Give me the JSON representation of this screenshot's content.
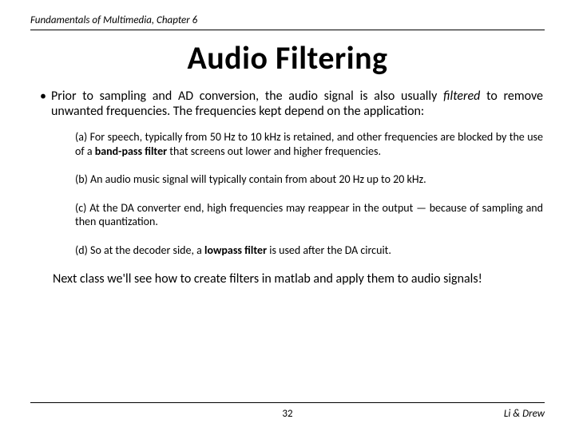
{
  "header": {
    "text": "Fundamentals of Multimedia, Chapter 6"
  },
  "title": "Audio Filtering",
  "bullet": {
    "marker": "•",
    "pre": "Prior to sampling and AD conversion, the audio signal is also usually ",
    "italic": "filtered",
    "post": " to remove unwanted frequencies. The frequencies kept depend on the application:"
  },
  "items": [
    {
      "label": "(a)",
      "pre": " For speech, typically from 50 Hz to 10 kHz is retained, and other frequencies are blocked by the use of a ",
      "bold": "band-pass filter",
      "post": " that screens out lower and higher frequencies."
    },
    {
      "label": "(b)",
      "pre": " An audio music signal will typically contain from about 20 Hz up to 20 kHz.",
      "bold": "",
      "post": ""
    },
    {
      "label": "(c)",
      "pre": " At the DA converter end, high frequencies may reappear in the output — because of sampling and then quantization.",
      "bold": "",
      "post": ""
    },
    {
      "label": "(d)",
      "pre": " So at the decoder side, a ",
      "bold": "lowpass filter",
      "post": " is used after the DA circuit."
    }
  ],
  "closing": "Next class we'll see how to create filters in matlab and apply them to audio signals!",
  "footer": {
    "page": "32",
    "authors": "Li & Drew"
  }
}
